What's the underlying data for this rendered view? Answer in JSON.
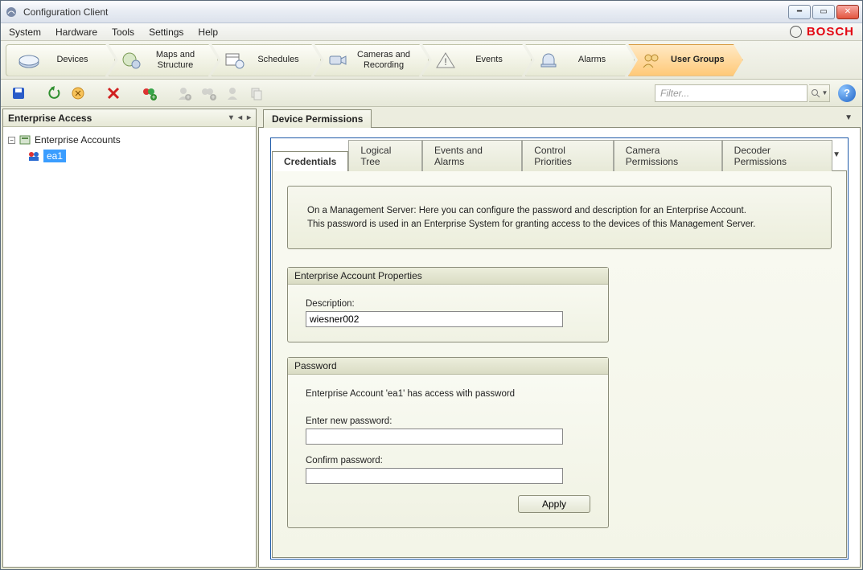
{
  "window": {
    "title": "Configuration Client"
  },
  "menu": {
    "items": [
      "System",
      "Hardware",
      "Tools",
      "Settings",
      "Help"
    ]
  },
  "brand": {
    "name": "BOSCH"
  },
  "nav": {
    "items": [
      {
        "label": "Devices"
      },
      {
        "label": "Maps and\nStructure"
      },
      {
        "label": "Schedules"
      },
      {
        "label": "Cameras and\nRecording"
      },
      {
        "label": "Events"
      },
      {
        "label": "Alarms"
      },
      {
        "label": "User Groups"
      }
    ],
    "active_index": 6
  },
  "toolbar": {
    "filter_placeholder": "Filter..."
  },
  "left": {
    "header": "Enterprise Access",
    "tree": {
      "root": {
        "label": "Enterprise Accounts"
      },
      "child": {
        "label": "ea1"
      }
    }
  },
  "right": {
    "section_title": "Device Permissions",
    "subtabs": [
      "Credentials",
      "Logical Tree",
      "Events and Alarms",
      "Control Priorities",
      "Camera Permissions",
      "Decoder Permissions"
    ],
    "active_subtab_index": 0,
    "info_line1": "On a Management Server: Here you can configure the password and description for an Enterprise Account.",
    "info_line2": "This password is used in an Enterprise System for granting access to the devices of this Management Server.",
    "group_props": {
      "title": "Enterprise Account Properties",
      "description_label": "Description:",
      "description_value": "wiesner002"
    },
    "group_pwd": {
      "title": "Password",
      "status_text": "Enterprise Account 'ea1' has access with password",
      "new_label": "Enter new password:",
      "confirm_label": "Confirm password:",
      "apply_label": "Apply"
    }
  }
}
